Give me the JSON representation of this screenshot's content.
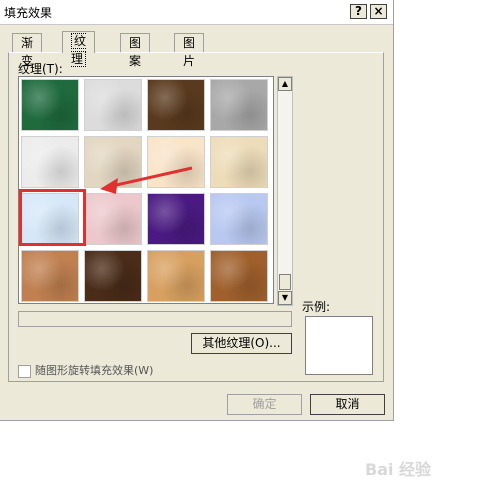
{
  "dialog": {
    "title": "填充效果",
    "help_label": "?",
    "close_label": "×"
  },
  "tabs": [
    {
      "label": "渐变"
    },
    {
      "label": "纹理",
      "active": true
    },
    {
      "label": "图案"
    },
    {
      "label": "图片"
    }
  ],
  "texture_panel": {
    "label": "纹理(T):",
    "textures": [
      {
        "name": "green-marble",
        "color": "#1f6b3e"
      },
      {
        "name": "white-marble",
        "color": "#dcdcdc"
      },
      {
        "name": "brown-marble",
        "color": "#5a3a1e"
      },
      {
        "name": "granite",
        "color": "#a8a8a8"
      },
      {
        "name": "paper",
        "color": "#ececec"
      },
      {
        "name": "sand",
        "color": "#e2d6c0"
      },
      {
        "name": "parchment",
        "color": "#f8e4c8"
      },
      {
        "name": "canvas",
        "color": "#eddcb8"
      },
      {
        "name": "blue-tissue",
        "color": "#d6e8f8"
      },
      {
        "name": "pink-tissue",
        "color": "#ecc8cc"
      },
      {
        "name": "purple-mesh",
        "color": "#4a1a82"
      },
      {
        "name": "bouquet",
        "color": "#b8c8f0"
      },
      {
        "name": "cork",
        "color": "#c08050"
      },
      {
        "name": "walnut",
        "color": "#4a2c18"
      },
      {
        "name": "oak",
        "color": "#d8a060"
      },
      {
        "name": "medium-wood",
        "color": "#a0602c"
      }
    ],
    "selected_index": 8
  },
  "buttons": {
    "other_textures": "其他纹理(O)...",
    "ok": "确定",
    "cancel": "取消"
  },
  "sample": {
    "label": "示例:"
  },
  "checkbox": {
    "label": "随图形旋转填充效果(W)",
    "checked": false
  },
  "watermark": {
    "text": "Bai 经验"
  },
  "colors": {
    "highlight": "#e03030",
    "dialog_bg": "#ece9d8"
  }
}
